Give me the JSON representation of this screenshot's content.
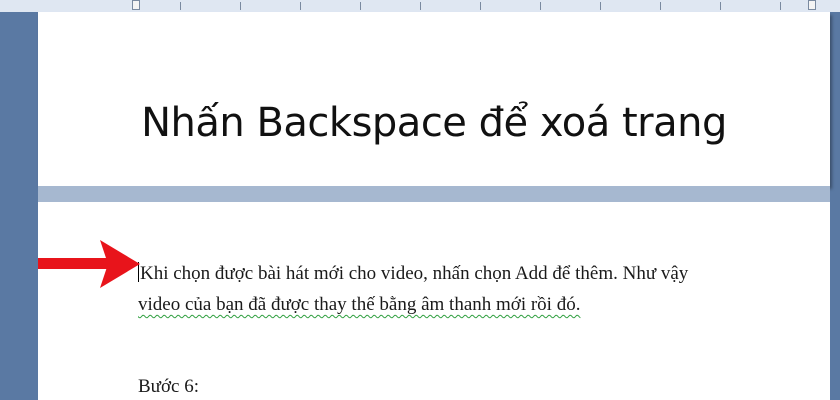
{
  "window": {
    "caption": "Nhấn Backspace để xoá trang"
  },
  "document": {
    "paragraph_lines": [
      "Khi chọn được bài hát mới cho video, nhấn chọn Add để thêm. Như vậy",
      "video của bạn đã được thay thế bằng âm thanh mới rồi đó."
    ],
    "step_label": "Bước 6:"
  },
  "colors": {
    "arrow": "#e8141b",
    "spellcheck": "#2e9e3e",
    "frame": "#5a79a3"
  },
  "icons": {
    "arrow": "right-arrow-icon"
  }
}
